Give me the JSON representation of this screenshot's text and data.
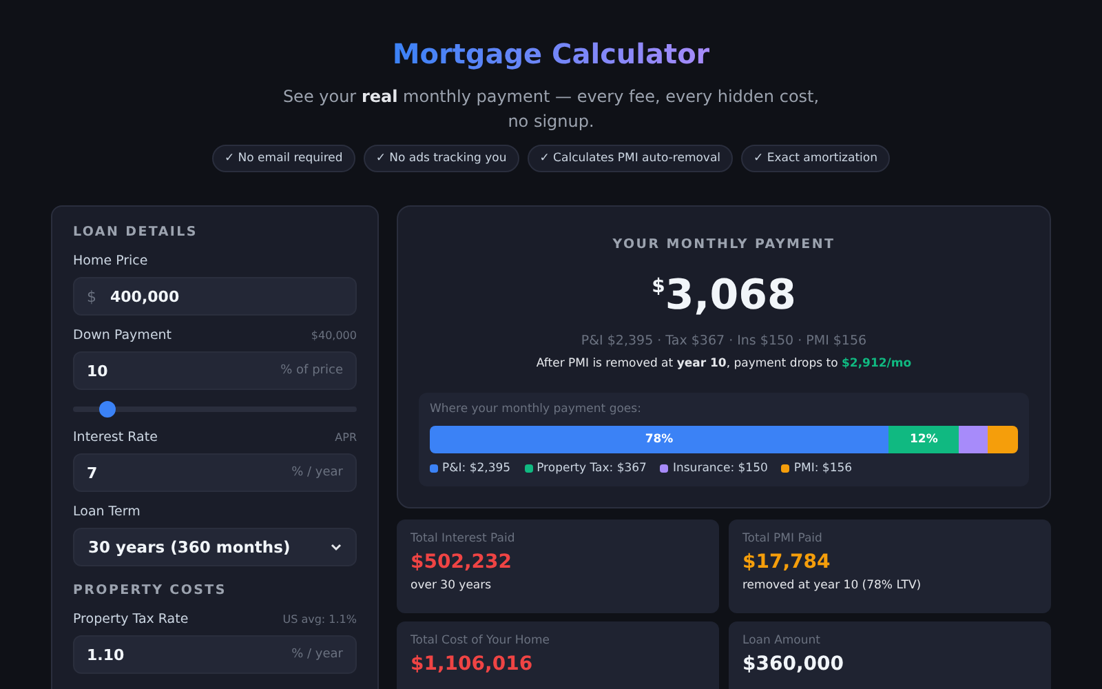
{
  "header": {
    "title": "Mortgage Calculator",
    "subtitle": "See your **real** monthly payment — every fee, every hidden cost, no signup.",
    "badges": [
      "✓ No email required",
      "✓ No ads tracking you",
      "✓ Calculates PMI auto-removal",
      "✓ Exact amortization"
    ]
  },
  "sidebar": {
    "sections": [
      {
        "title": "LOAN DETAILS",
        "fields": [
          {
            "kind": "input",
            "label": "Home Price",
            "prefix": "$",
            "value": "400,000"
          },
          {
            "kind": "input",
            "label": "Down Payment",
            "hint": "$40,000",
            "value": "10",
            "suffix": "% of price"
          },
          {
            "kind": "slider",
            "level": 0.12
          },
          {
            "kind": "input",
            "label": "Interest Rate",
            "hint": "APR",
            "value": "7",
            "suffix": "% / year"
          },
          {
            "kind": "select",
            "label": "Loan Term",
            "value": "30 years (360 months)"
          }
        ]
      },
      {
        "title": "PROPERTY COSTS",
        "fields": [
          {
            "kind": "input",
            "label": "Property Tax Rate",
            "hint": "US avg: 1.1%",
            "value": "1.10",
            "suffix": "% / year"
          }
        ]
      }
    ]
  },
  "summary": {
    "heading": "YOUR MONTHLY PAYMENT",
    "currency": "$",
    "amount": "3,068",
    "breakdown": "P&I $2,395 · Tax $367 · Ins $150 · PMI $156",
    "note": {
      "text": "After PMI is removed at **year 10**, payment drops to",
      "amount": "$2,912/mo"
    },
    "distribution": {
      "title": "Where your monthly payment goes:",
      "segments": [
        {
          "label": "78%",
          "color": "#3b82f6"
        },
        {
          "label": "12%",
          "color": "#10b981"
        },
        {
          "color": "#a78bfa"
        },
        {
          "color": "#f59e0b"
        }
      ],
      "legend": [
        {
          "label": "P&I: $2,395",
          "color": "#3b82f6"
        },
        {
          "label": "Property Tax: $367",
          "color": "#10b981"
        },
        {
          "label": "Insurance: $150",
          "color": "#a78bfa"
        },
        {
          "label": "PMI: $156",
          "color": "#f59e0b"
        }
      ]
    }
  },
  "stats": [
    {
      "label": "Total Interest Paid",
      "value": "$502,232",
      "color": "#ef4444",
      "note": "over 30 years"
    },
    {
      "label": "Total PMI Paid",
      "value": "$17,784",
      "color": "#f59e0b",
      "note": "removed at year 10 (78% LTV)"
    },
    {
      "label": "Total Cost of Your Home",
      "value": "$1,106,016",
      "color": "#ef4444"
    },
    {
      "label": "Loan Amount",
      "value": "$360,000",
      "color": "#f1f5f9"
    }
  ]
}
